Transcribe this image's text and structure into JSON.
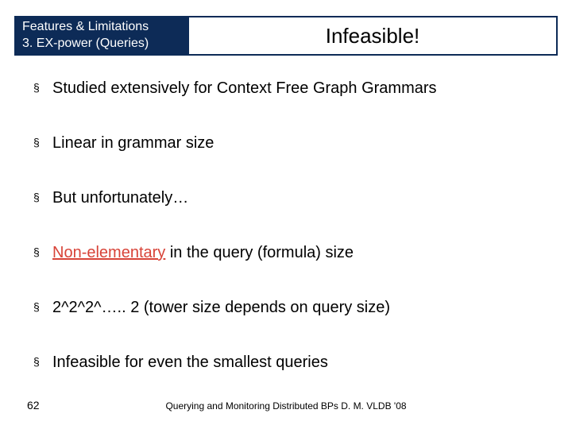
{
  "header": {
    "left_line1": "Features & Limitations",
    "left_line2": "3. EX-power (Queries)",
    "right": "Infeasible!"
  },
  "bullets": [
    {
      "plain": "Studied extensively for Context Free Graph Grammars"
    },
    {
      "plain": "Linear in grammar size"
    },
    {
      "plain": "But unfortunately…"
    },
    {
      "red_underline_prefix": "Non-elementary",
      "rest": " in the query (formula) size"
    },
    {
      "plain": "2^2^2^….. 2 (tower size depends on query size)"
    },
    {
      "plain": "Infeasible for even the smallest queries"
    }
  ],
  "footer": {
    "page": "62",
    "text": "Querying and Monitoring Distributed BPs D. M. VLDB '08"
  }
}
